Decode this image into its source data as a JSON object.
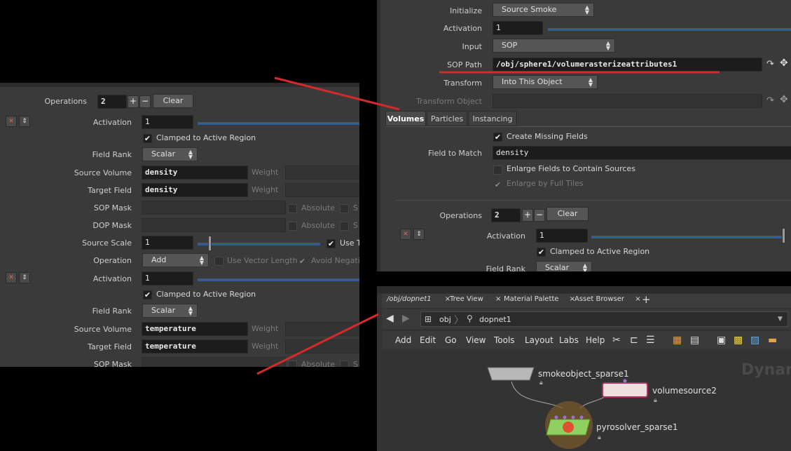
{
  "left": {
    "operations": {
      "label": "Operations",
      "value": "2",
      "plus": "+",
      "minus": "−",
      "clear": "Clear"
    },
    "entries": [
      {
        "activation_label": "Activation",
        "activation_value": "1",
        "clamped_label": "Clamped to Active Region",
        "field_rank_label": "Field Rank",
        "field_rank_value": "Scalar",
        "source_volume_label": "Source Volume",
        "source_volume_value": "density",
        "target_field_label": "Target Field",
        "target_field_value": "density",
        "weight_label": "Weight",
        "sop_mask_label": "SOP Mask",
        "dop_mask_label": "DOP Mask",
        "absolute_label": "Absolute",
        "cut_label": "S",
        "source_scale_label": "Source Scale",
        "source_scale_value": "1",
        "use_label": "Use T",
        "operation_label": "Operation",
        "operation_value": "Add",
        "use_vector_length_label": "Use Vector Length",
        "avoid_negative_label": "Avoid Negativ"
      },
      {
        "activation_label": "Activation",
        "activation_value": "1",
        "clamped_label": "Clamped to Active Region",
        "field_rank_label": "Field Rank",
        "field_rank_value": "Scalar",
        "source_volume_label": "Source Volume",
        "source_volume_value": "temperature",
        "target_field_label": "Target Field",
        "target_field_value": "temperature",
        "weight_label": "Weight",
        "sop_mask_label": "SOP Mask",
        "absolute_label": "Absolute",
        "cut_label": "S"
      }
    ]
  },
  "right": {
    "initialize_label": "Initialize",
    "initialize_value": "Source Smoke",
    "activation_label": "Activation",
    "activation_value": "1",
    "input_label": "Input",
    "input_value": "SOP",
    "sop_path_label": "SOP Path",
    "sop_path_value": "/obj/sphere1/volumerasterizeattributes1",
    "transform_label": "Transform",
    "transform_value": "Into This Object",
    "transform_object_label": "Transform Object",
    "tabs": [
      "Volumes",
      "Particles",
      "Instancing"
    ],
    "create_missing_label": "Create Missing Fields",
    "field_to_match_label": "Field to Match",
    "field_to_match_value": "density",
    "enlarge_label": "Enlarge Fields to Contain Sources",
    "enlarge_tiles_label": "Enlarge by Full Tiles",
    "operations_label": "Operations",
    "operations_value": "2",
    "plus": "+",
    "minus": "−",
    "clear": "Clear",
    "op_activation_label": "Activation",
    "op_activation_value": "1",
    "clamped_label": "Clamped to Active Region",
    "field_rank_label": "Field Rank",
    "field_rank_value": "Scalar"
  },
  "network": {
    "tabs": [
      {
        "label": "/obj/dopnet1",
        "close": "×"
      },
      {
        "label": "Tree View",
        "close": "×"
      },
      {
        "label": "Material Palette",
        "close": "×"
      },
      {
        "label": "Asset Browser",
        "close": "×"
      }
    ],
    "add_tab": "+",
    "path": [
      "obj",
      "dopnet1"
    ],
    "menu": [
      "Add",
      "Edit",
      "Go",
      "View",
      "Tools",
      "Layout",
      "Labs",
      "Help"
    ],
    "watermark": "Dynam",
    "nodes": [
      "smokeobject_sparse1",
      "volumesource2",
      "pyrosolver_sparse1"
    ]
  },
  "colors": {
    "annotation": "#d42a2a",
    "slider": "#2f5d9c",
    "panel": "#3a3a3a"
  }
}
